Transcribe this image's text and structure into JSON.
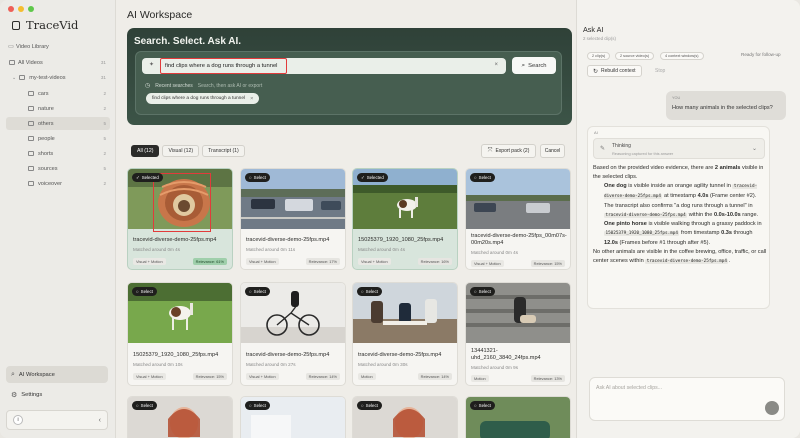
{
  "app": {
    "name": "TraceVid"
  },
  "sidebar": {
    "video_library": "Video Library",
    "all_videos": {
      "label": "All Videos",
      "count": "31"
    },
    "folder_root": {
      "label": "my-test-videos",
      "count": "31"
    },
    "folders": [
      {
        "label": "cars",
        "count": "2"
      },
      {
        "label": "nature",
        "count": "2"
      },
      {
        "label": "others",
        "count": "5"
      },
      {
        "label": "people",
        "count": "5"
      },
      {
        "label": "shorts",
        "count": "2"
      },
      {
        "label": "sources",
        "count": "5"
      },
      {
        "label": "voiceover",
        "count": "2"
      }
    ],
    "ai_workspace": "AI Workspace",
    "settings": "Settings",
    "avatar_letter": "i"
  },
  "main": {
    "title": "AI Workspace",
    "hero_title": "Search. Select. Ask AI.",
    "query": "find clips where a dog runs through a tunnel",
    "search_label": "Search",
    "recent_label": "Recent searches",
    "recent_hint": "Search, then ask AI or export",
    "recent_chip": "find clips where a dog runs through a tunnel",
    "tabs": [
      {
        "label": "All (12)"
      },
      {
        "label": "Visual (12)"
      },
      {
        "label": "Transcript (1)"
      }
    ],
    "export_label": "Export pack (2)",
    "cancel_label": "Cancel"
  },
  "cards": [
    {
      "badge": "Selected",
      "title": "tracevid-diverse-demo-25fps.mp4",
      "sub": "Matched around 0m 4s",
      "tag": "Visual + Motion",
      "rel": "Relevance: 61%"
    },
    {
      "badge": "Select",
      "title": "tracevid-diverse-demo-25fps.mp4",
      "sub": "Matched around 0m 11s",
      "tag": "Visual + Motion",
      "rel": "Relevance: 17%"
    },
    {
      "badge": "Selected",
      "title": "15025379_1920_1080_25fps.mp4",
      "sub": "Matched around 0m 4s",
      "tag": "Visual + Motion",
      "rel": "Relevance: 16%"
    },
    {
      "badge": "Select",
      "title": "tracevid-diverse-demo-25fps_00m07s-00m20s.mp4",
      "sub": "Matched around 0m 4s",
      "tag": "Visual + Motion",
      "rel": "Relevance: 15%"
    },
    {
      "badge": "Select",
      "title": "15025379_1920_1080_25fps.mp4",
      "sub": "Matched around 0m 10s",
      "tag": "Visual + Motion",
      "rel": "Relevance: 15%"
    },
    {
      "badge": "Select",
      "title": "tracevid-diverse-demo-25fps.mp4",
      "sub": "Matched around 0m 27s",
      "tag": "Visual + Motion",
      "rel": "Relevance: 14%"
    },
    {
      "badge": "Select",
      "title": "tracevid-diverse-demo-25fps.mp4",
      "sub": "Matched around 0m 30s",
      "tag": "Motion",
      "rel": "Relevance: 14%"
    },
    {
      "badge": "Select",
      "title": "13441321-uhd_2160_3840_24fps.mp4",
      "sub": "Matched around 0m 9s",
      "tag": "Motion",
      "rel": "Relevance: 13%"
    },
    {
      "badge": "Select"
    },
    {
      "badge": "Select"
    },
    {
      "badge": "Select"
    },
    {
      "badge": "Select"
    }
  ],
  "ask": {
    "title": "Ask AI",
    "subtitle": "2 selected clip(s)",
    "pills": [
      "2 clip(s)",
      "2 source video(s)",
      "4 context window(s)"
    ],
    "ready": "Ready for follow-up",
    "rebuild": "Rebuild context",
    "stop": "Stop",
    "you_label": "YOU",
    "question": "How many animals in the selected clips?",
    "ai_label": "AI",
    "thinking": "Thinking",
    "thinking_sub": "Reasoning captured for this answer",
    "answer_lead_1": "Based on the provided video evidence, there are ",
    "answer_lead_b": "2 animals",
    "answer_lead_2": " visible in the selected clips.",
    "dog_b": "One dog",
    "dog_1": " is visible inside an orange agility tunnel in ",
    "dog_code1": "tracevid-diverse-demo-25fps.mp4",
    "dog_2": " at timestamp ",
    "dog_ts": "4.0s",
    "dog_3": " (Frame center #2). The transcript also confirms \"a dog runs through a tunnel\" in ",
    "dog_code2": "tracevid-diverse-demo-25fps.mp4",
    "dog_4": " within the ",
    "dog_range": "0.0s-10.0s",
    "dog_5": " range.",
    "horse_b": "One pinto horse",
    "horse_1": " is visible walking through a grassy paddock in ",
    "horse_code": "15025379_1920_1080_25fps.mp4",
    "horse_2": " from timestamp ",
    "horse_t1": "0.3s",
    "horse_3": " through ",
    "horse_t2": "12.0s",
    "horse_4": " (Frames before #1 through after #5).",
    "tail_1": "No other animals are visible in the coffee brewing, office, traffic, or call center scenes within ",
    "tail_code": "tracevid-diverse-demo-25fps.mp4",
    "tail_2": ".",
    "input_placeholder": "Ask AI about selected clips..."
  },
  "colors": {
    "accent_dark": "#2f4138",
    "highlight": "#e23b3b",
    "selected_card": "#d8e5dc"
  }
}
